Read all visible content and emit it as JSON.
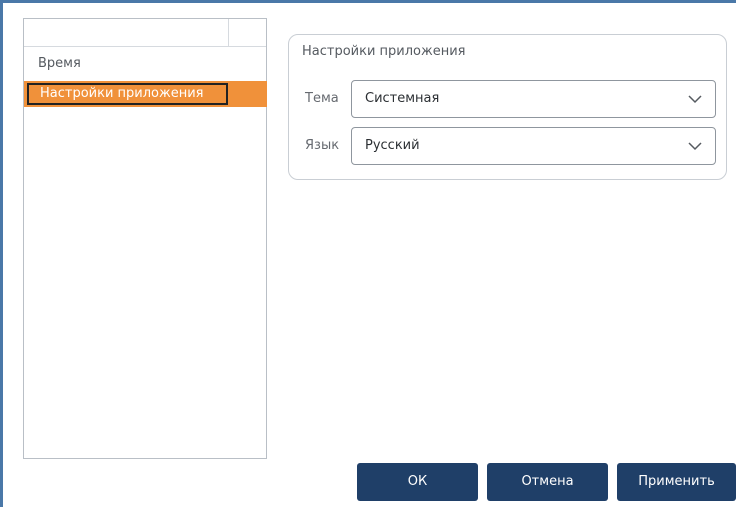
{
  "nav": {
    "items": [
      {
        "label": "Время",
        "selected": false
      },
      {
        "label": "Настройки приложения",
        "selected": true
      }
    ],
    "selected_color": "#f0913a"
  },
  "settings_group": {
    "title": "Настройки приложения",
    "theme": {
      "label": "Тема",
      "value": "Системная",
      "icon": "chevron-down-icon"
    },
    "language": {
      "label": "Язык",
      "value": "Русский",
      "icon": "chevron-down-icon"
    }
  },
  "buttons": {
    "ok_label": "ОК",
    "cancel_label": "Отмена",
    "apply_label": "Применить",
    "color": "#1f3f68"
  },
  "window": {
    "accent_color": "#4a78a8"
  }
}
